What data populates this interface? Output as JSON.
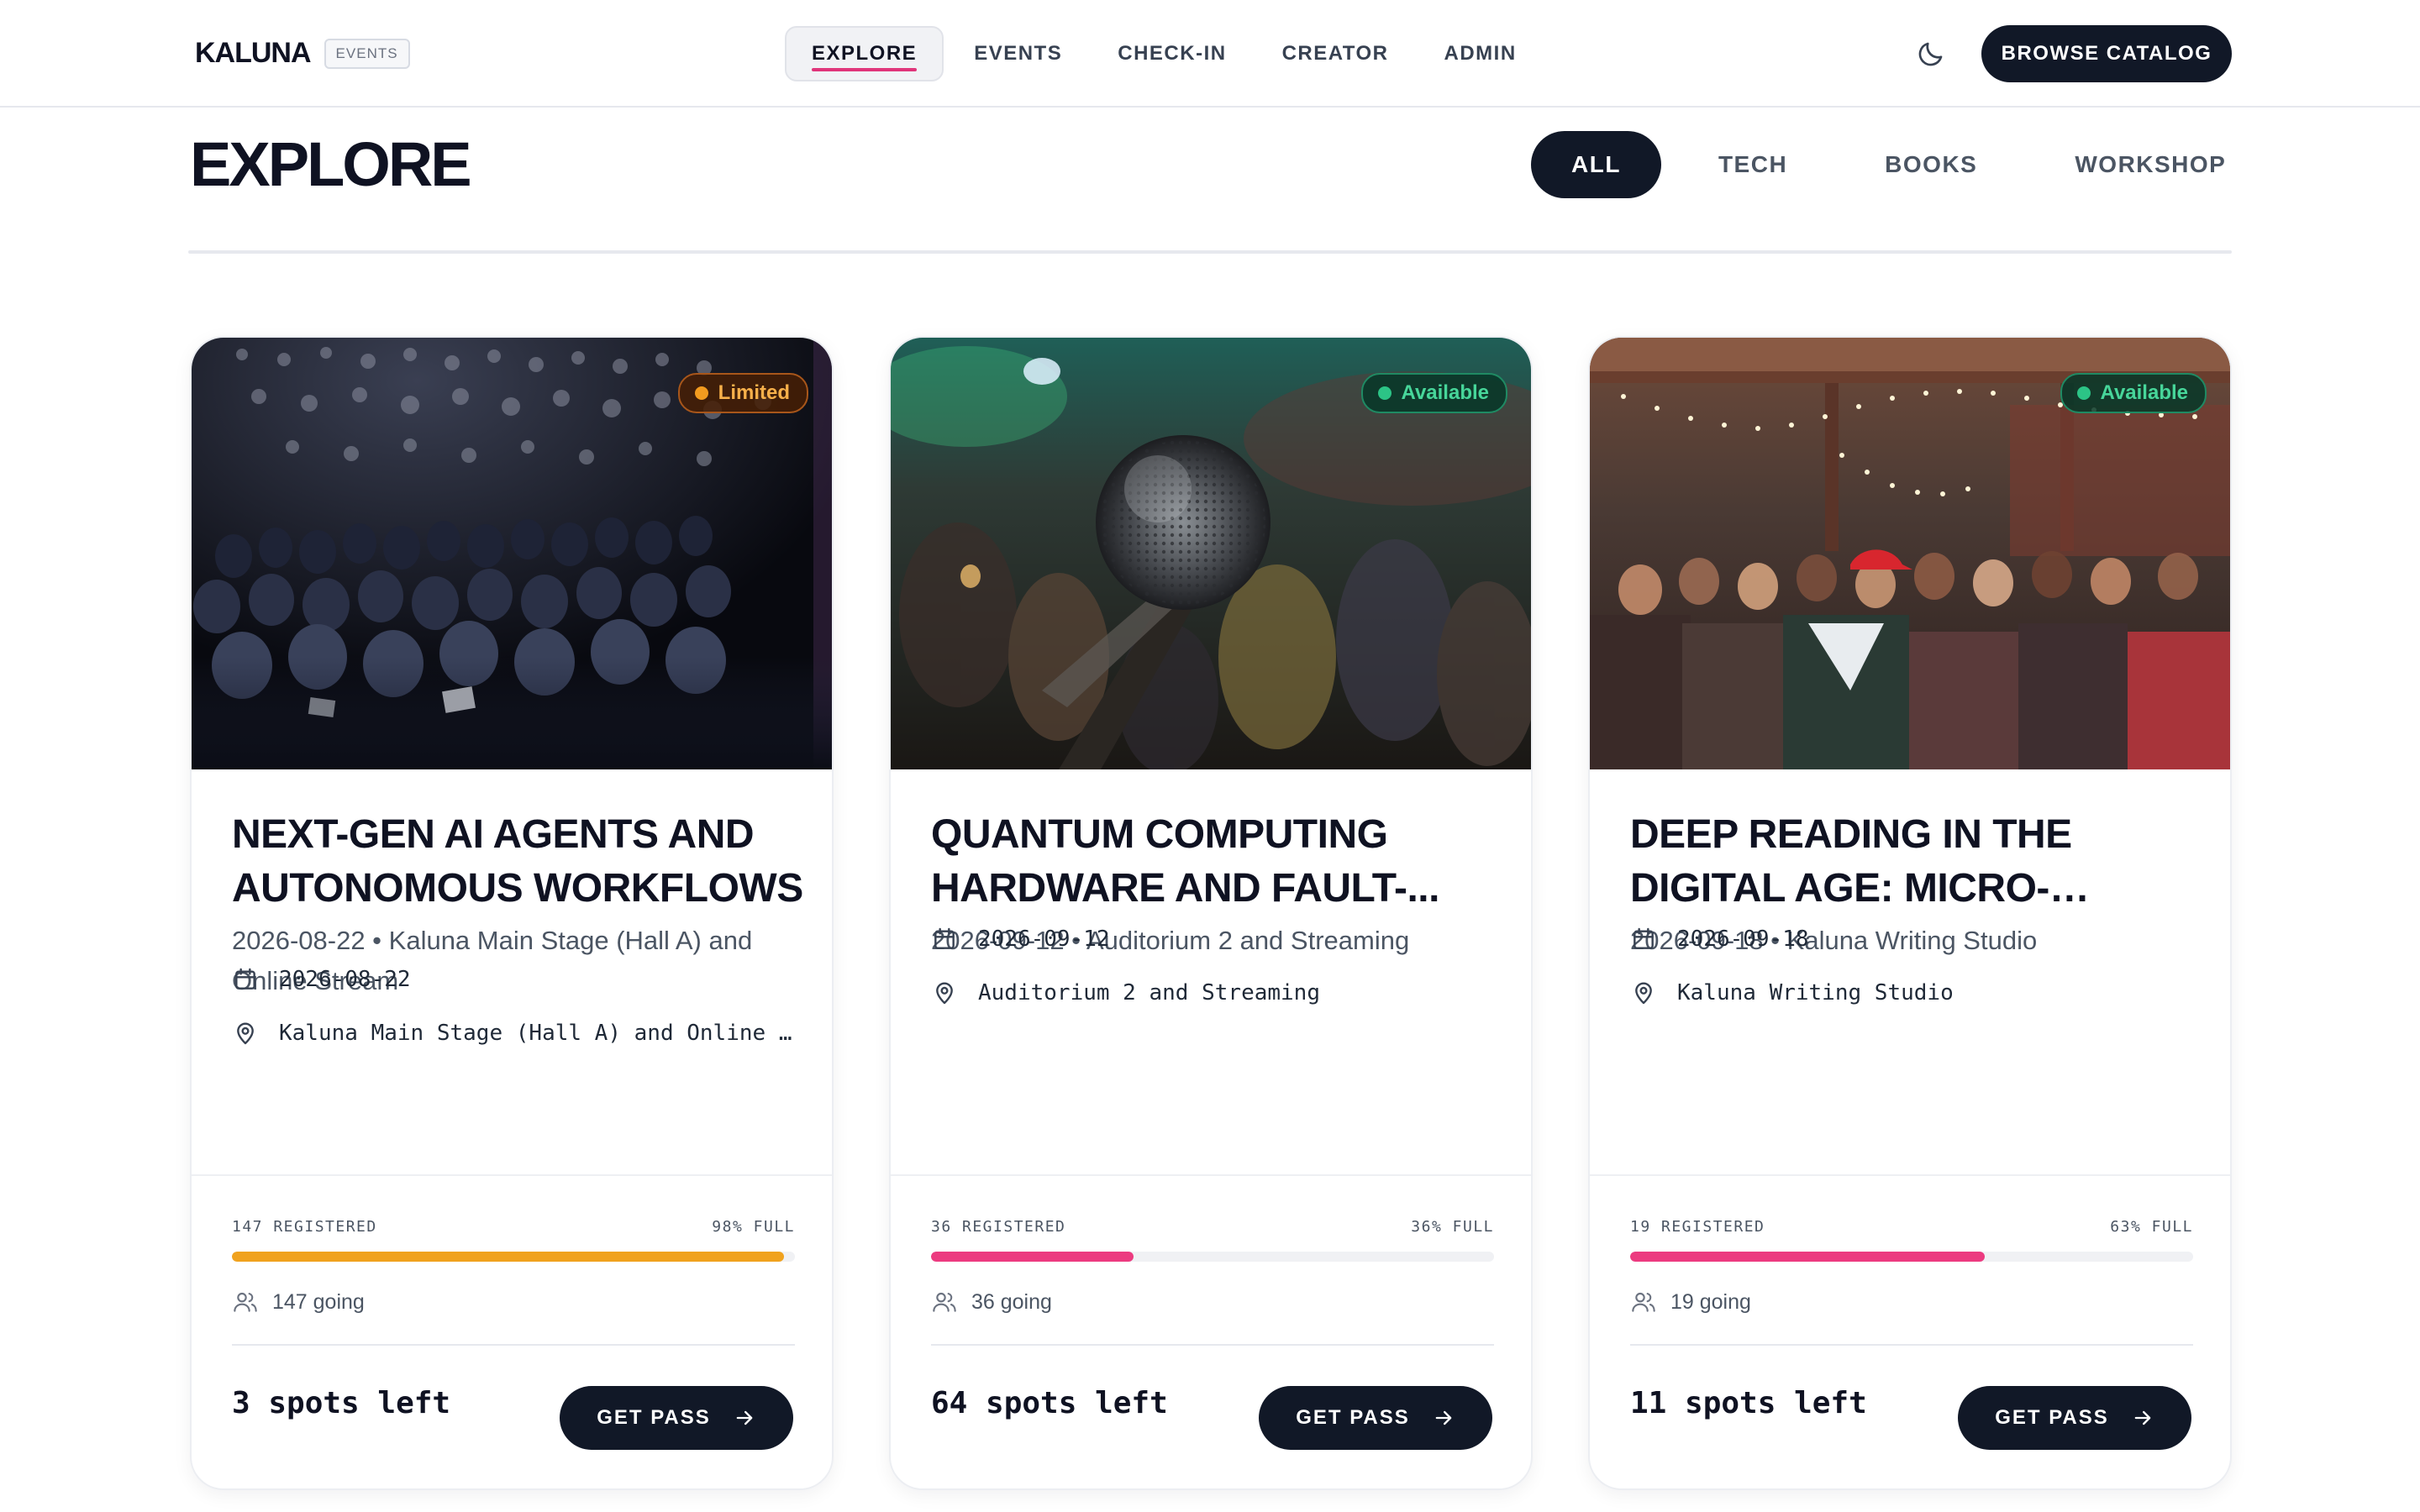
{
  "header": {
    "brand": "KALUNA",
    "brand_badge": "EVENTS",
    "nav": [
      "EXPLORE",
      "EVENTS",
      "CHECK-IN",
      "CREATOR",
      "ADMIN"
    ],
    "active_nav": "EXPLORE",
    "theme_icon": "moon-icon",
    "catalog_button": "BROWSE CATALOG"
  },
  "page": {
    "title": "EXPLORE",
    "filters": [
      "ALL",
      "TECH",
      "BOOKS",
      "WORKSHOP"
    ],
    "active_filter": "ALL"
  },
  "colors": {
    "accent": "#e0357a",
    "dark": "#111827",
    "warning": "#f29b1f",
    "success": "#2cc486"
  },
  "cards": [
    {
      "status": "Limited",
      "title": "NEXT-GEN AI AGENTS AND AUTONOMOUS WORKFLOWS",
      "subtitle": "2026-08-22 • Kaluna Main Stage (Hall A) and Online Stream",
      "date": "2026-08-22",
      "location": "Kaluna Main Stage (Hall A) and Online Stream",
      "registered_label": "147 REGISTERED",
      "full_label": "98% FULL",
      "fill_percent": 98,
      "fill_color": "#f0a21e",
      "going": "147 going",
      "spots_left": "3 spots left",
      "cta": "GET PASS"
    },
    {
      "status": "Available",
      "title": "QUANTUM COMPUTING HARDWARE AND FAULT-...",
      "subtitle": "2026-09-12 • Auditorium 2 and Streaming",
      "date": "2026-09-12",
      "location": "Auditorium 2 and Streaming",
      "registered_label": "36 REGISTERED",
      "full_label": "36% FULL",
      "fill_percent": 36,
      "fill_color": "#ec3b80",
      "going": "36 going",
      "spots_left": "64 spots left",
      "cta": "GET PASS"
    },
    {
      "status": "Available",
      "title": "DEEP READING IN THE DIGITAL AGE: MICRO-ESSAY...",
      "subtitle": "2026-09-18 • Kaluna Writing Studio",
      "date": "2026-09-18",
      "location": "Kaluna Writing Studio",
      "registered_label": "19 REGISTERED",
      "full_label": "63% FULL",
      "fill_percent": 63,
      "fill_color": "#ec3b80",
      "going": "19 going",
      "spots_left": "11 spots left",
      "cta": "GET PASS"
    }
  ]
}
